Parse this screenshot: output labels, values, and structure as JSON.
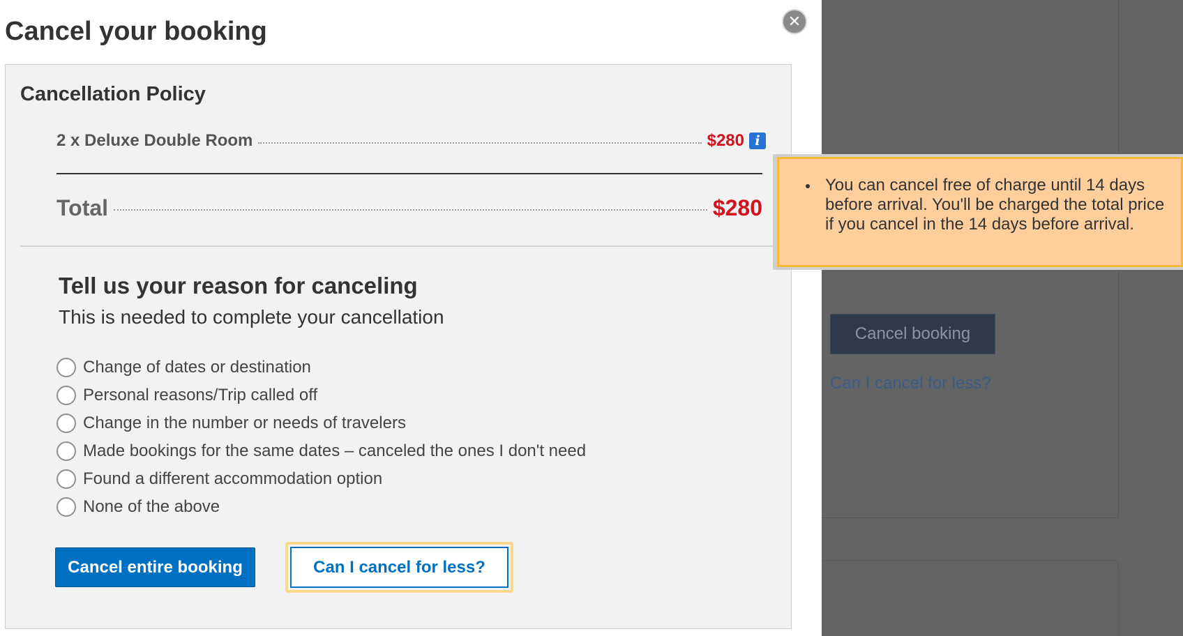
{
  "modal": {
    "title": "Cancel your booking",
    "close_icon": "close-icon"
  },
  "policy": {
    "title": "Cancellation Policy",
    "room_label": "2 x Deluxe Double Room",
    "room_price": "$280",
    "info_icon": "i",
    "total_label": "Total",
    "total_price": "$280"
  },
  "reason": {
    "title": "Tell us your reason for canceling",
    "subtitle": "This is needed to complete your cancellation",
    "options": [
      "Change of dates or destination",
      "Personal reasons/Trip called off",
      "Change in the number or needs of travelers",
      "Made bookings for the same dates – canceled the ones I don't need",
      "Found a different accommodation option",
      "None of the above"
    ]
  },
  "actions": {
    "cancel_entire": "Cancel entire booking",
    "cancel_for_less": "Can I cancel for less?"
  },
  "tooltip": {
    "text": "You can cancel free of charge until 14 days before arrival. You'll be charged the total price if you cancel in the 14 days before arrival."
  },
  "background": {
    "cancel_button": "Cancel booking",
    "cancel_less_link": "Can I cancel for less?"
  },
  "colors": {
    "accent": "#0071c2",
    "price_red": "#d4111e",
    "tooltip_bg": "#fecf9d",
    "overlay": "#646464"
  }
}
